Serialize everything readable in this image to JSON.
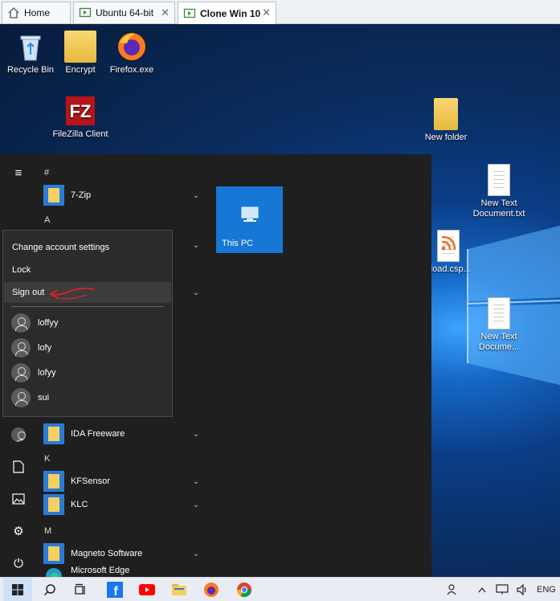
{
  "vm_tabs": [
    {
      "label": "Home",
      "icon": "home-icon",
      "closable": false
    },
    {
      "label": "Ubuntu 64-bit",
      "icon": "vm-icon",
      "closable": true
    },
    {
      "label": "Clone Win 10",
      "icon": "vm-icon",
      "closable": true,
      "active": true
    }
  ],
  "desktop_icons": {
    "recycle_bin": "Recycle Bin",
    "encrypt": "Encrypt",
    "firefox": "Firefox.exe",
    "filezilla": "FileZilla Client",
    "new_folder": "New folder",
    "new_text_doc": "New Text Document.txt",
    "upload_csp": "ylоad.csp...",
    "new_text_doc2": "New Text Docume..."
  },
  "start_menu": {
    "sections": {
      "hash": "#",
      "a": "A",
      "k": "K",
      "m": "M"
    },
    "apps": {
      "seven_zip": "7-Zip",
      "ida": "IDA Freeware",
      "kfsensor": "KFSensor",
      "klc": "KLC",
      "magneto": "Magneto Software",
      "edge": "Microsoft Edge"
    },
    "tile_this_pc": "This PC"
  },
  "account_flyout": {
    "change_settings": "Change account settings",
    "lock": "Lock",
    "sign_out": "Sign out",
    "users": [
      "loffyy",
      "lofy",
      "lofyy",
      "sui"
    ]
  },
  "taskbar": {
    "language": "ENG"
  },
  "colors": {
    "accent": "#1677d6",
    "start_bg": "#1f1f1f",
    "annotation": "#e02020"
  }
}
